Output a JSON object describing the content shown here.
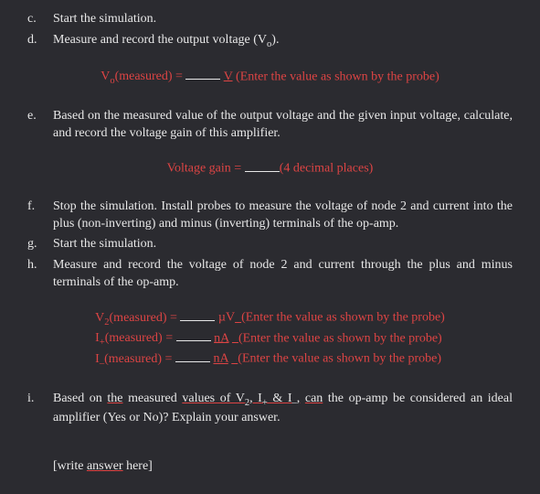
{
  "items": {
    "c": {
      "marker": "c.",
      "text": "Start the simulation."
    },
    "d": {
      "marker": "d.",
      "text": "Measure and record the output voltage (V",
      "sub": "o",
      "tail": ")."
    },
    "e": {
      "marker": "e.",
      "text": "Based on the measured value of the output voltage and the given input voltage, calculate, and record the voltage gain of this amplifier."
    },
    "f": {
      "marker": "f.",
      "text": "Stop the simulation. Install probes to measure the voltage of node 2 and current into the plus (non-inverting) and minus (inverting) terminals of the op-amp."
    },
    "g": {
      "marker": "g.",
      "text": "Start the simulation."
    },
    "h": {
      "marker": "h.",
      "text": "Measure and record the voltage of node 2 and current through the plus and minus terminals of the op-amp."
    },
    "i": {
      "marker": "i.",
      "pre": "Based on",
      "mid1": "the",
      "post1": "measured",
      "mid2": "values of V",
      "sub2": "2",
      "post2": ", I",
      "sub3": "+",
      "post3": " & I",
      "sub4": "–",
      "post4": ",",
      "mid3": "can",
      "tail": "the op-amp be considered an ideal amplifier (Yes or No)? Explain your answer."
    }
  },
  "eq": {
    "vo": {
      "lhs_pre": "V",
      "lhs_sub": "o",
      "lhs_post": "(measured) = ",
      "unit": "V",
      "hint": "(Enter the value as shown by the probe)"
    },
    "gain": {
      "lhs": "Voltage gain = ",
      "hint": "(4 decimal places)"
    },
    "v2": {
      "lhs_pre": "V",
      "lhs_sub": "2",
      "lhs_post": "(measured) = ",
      "unit": "µV",
      "hint": "(Enter the value as shown by the probe)"
    },
    "ip": {
      "lhs_pre": "I",
      "lhs_sub": "+",
      "lhs_post": "(measured) = ",
      "unit": "nA",
      "hint": "(Enter the value as shown by the probe)"
    },
    "im": {
      "lhs_pre": "I",
      "lhs_sub": "–",
      "lhs_post": "(measured) = ",
      "unit": "nA",
      "hint": "(Enter the value as shown by the probe)"
    }
  },
  "answer": {
    "open": "[write ",
    "word": "answer",
    "close": " here]"
  }
}
